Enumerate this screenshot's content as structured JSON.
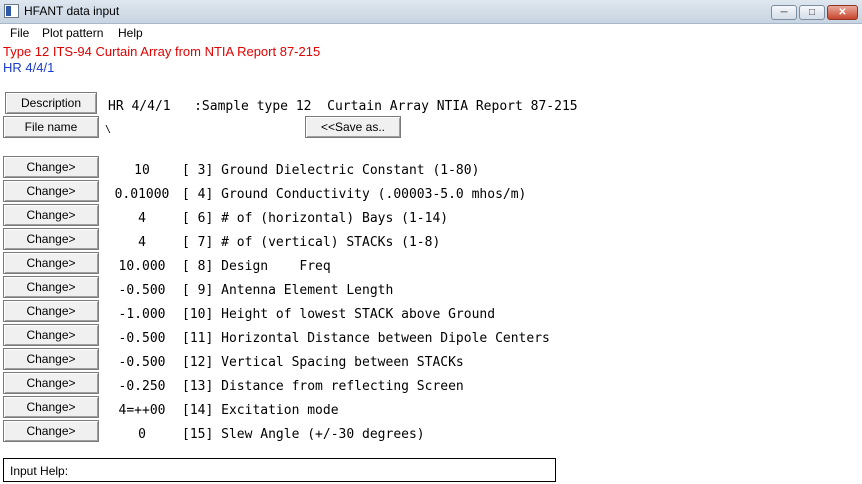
{
  "window": {
    "title": "HFANT data input"
  },
  "menu": [
    {
      "label": "File"
    },
    {
      "label": "Plot pattern"
    },
    {
      "label": "Help"
    }
  ],
  "header": {
    "line1": "Type 12 ITS-94  Curtain Array from NTIA Report 87-215",
    "line2": "HR 4/4/1"
  },
  "buttons": {
    "description": "Description",
    "file_name": "File name",
    "save_as": "<<Save as..",
    "change": "Change>"
  },
  "description_text": "HR 4/4/1   :Sample type 12  Curtain Array NTIA Report 87-215",
  "file_name_value": "\\",
  "params": [
    {
      "value": "10",
      "desc": "[ 3] Ground Dielectric Constant (1-80)"
    },
    {
      "value": "0.01000",
      "desc": "[ 4] Ground Conductivity (.00003-5.0 mhos/m)"
    },
    {
      "value": "4",
      "desc": "[ 6] # of (horizontal) Bays (1-14)"
    },
    {
      "value": "4",
      "desc": "[ 7] # of (vertical) STACKs (1-8)"
    },
    {
      "value": "10.000",
      "desc": "[ 8] Design    Freq"
    },
    {
      "value": "-0.500",
      "desc": "[ 9] Antenna Element Length"
    },
    {
      "value": "-1.000",
      "desc": "[10] Height of lowest STACK above Ground"
    },
    {
      "value": "-0.500",
      "desc": "[11] Horizontal Distance between Dipole Centers"
    },
    {
      "value": "-0.500",
      "desc": "[12] Vertical Spacing between STACKs"
    },
    {
      "value": "-0.250",
      "desc": "[13] Distance from reflecting Screen"
    },
    {
      "value": "4=++00",
      "desc": "[14] Excitation mode"
    },
    {
      "value": "0",
      "desc": "[15] Slew Angle (+/-30 degrees)"
    }
  ],
  "input_help": {
    "label": "Input Help:"
  },
  "icons": {
    "app": "window-app-icon",
    "minimize": "minimize-icon",
    "maximize": "maximize-icon",
    "close": "close-icon"
  }
}
